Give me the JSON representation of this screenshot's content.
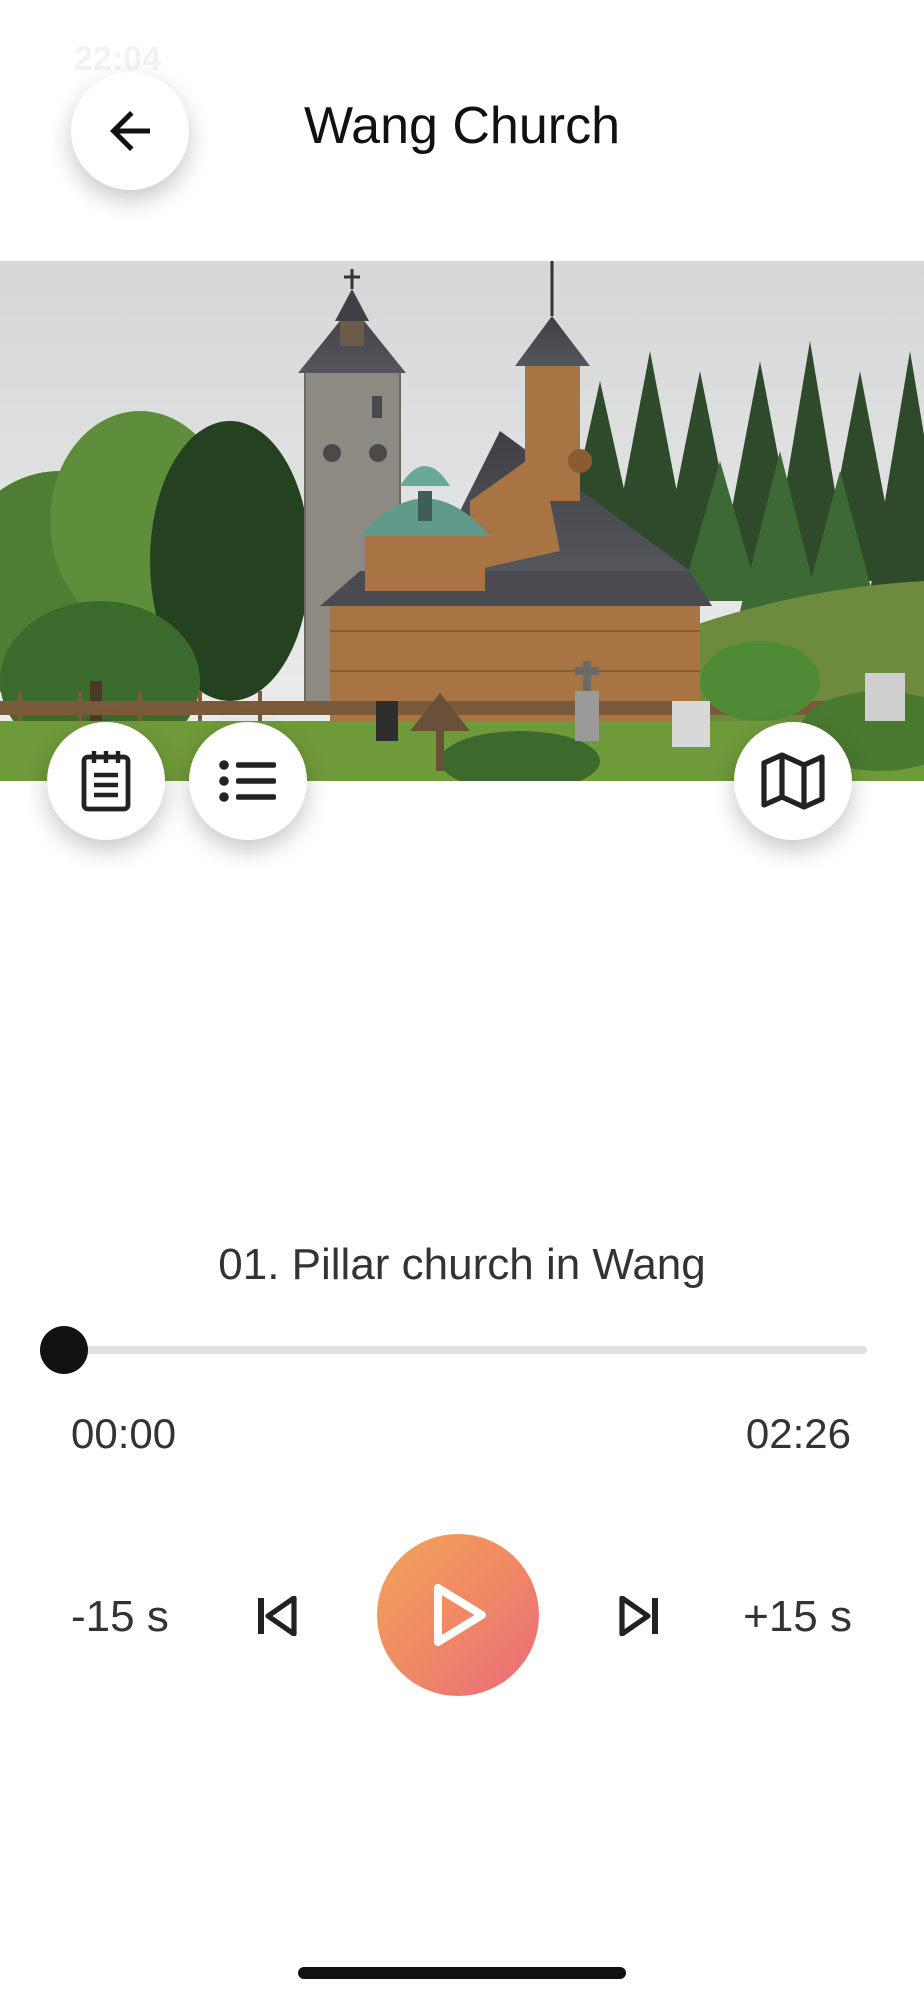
{
  "status_bar": {
    "time": "22:04"
  },
  "header": {
    "title": "Wang Church"
  },
  "hero": {
    "image_subject": "wooden stave church with stone bell tower in a cemetery surrounded by trees"
  },
  "player": {
    "track_title": "01. Pillar church in Wang",
    "current_time": "00:00",
    "total_time": "02:26",
    "progress": 0,
    "rewind_label": "-15 s",
    "forward_label": "+15 s"
  },
  "icons": {
    "back": "arrow-left-icon",
    "notes": "notepad-icon",
    "list": "list-icon",
    "map": "map-icon",
    "prev": "skip-previous-icon",
    "play": "play-icon",
    "next": "skip-next-icon"
  },
  "colors": {
    "play_gradient_start": "#f2a25a",
    "play_gradient_end": "#ea6a7c",
    "thumb": "#111111",
    "track": "#e0e0e0"
  }
}
